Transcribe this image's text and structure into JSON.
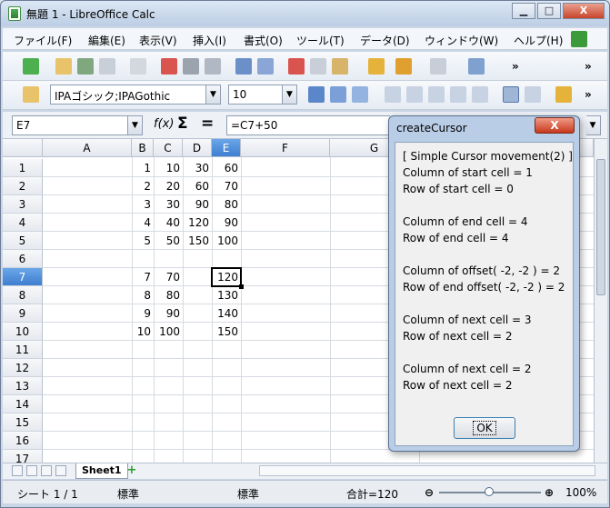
{
  "window": {
    "title": "無題 1 - LibreOffice Calc",
    "min": "▁",
    "max": "□",
    "close": "X"
  },
  "menu": [
    "ファイル(F)",
    "編集(E)",
    "表示(V)",
    "挿入(I)",
    "書式(O)",
    "ツール(T)",
    "データ(D)",
    "ウィンドウ(W)",
    "ヘルプ(H)"
  ],
  "format": {
    "font_name": "IPAゴシック;IPAGothic",
    "font_size": "10"
  },
  "formula": {
    "cell_ref": "E7",
    "content": "=C7+50"
  },
  "columns": [
    "A",
    "B",
    "C",
    "D",
    "E",
    "F",
    "G"
  ],
  "rows": [
    "1",
    "2",
    "3",
    "4",
    "5",
    "6",
    "7",
    "8",
    "9",
    "10",
    "11",
    "12",
    "13",
    "14",
    "15",
    "16",
    "17"
  ],
  "cells": {
    "B": [
      "1",
      "2",
      "3",
      "4",
      "5",
      "",
      "7",
      "8",
      "9",
      "10"
    ],
    "C": [
      "10",
      "20",
      "30",
      "40",
      "50",
      "",
      "70",
      "80",
      "90",
      "100"
    ],
    "D": [
      "30",
      "60",
      "90",
      "120",
      "150",
      "",
      "",
      "",
      "",
      ""
    ],
    "E": [
      "60",
      "70",
      "80",
      "90",
      "100",
      "",
      "120",
      "130",
      "140",
      "150"
    ]
  },
  "sheet_tab": "Sheet1",
  "status": {
    "sheet": "シート 1 / 1",
    "style": "標準",
    "mode": "標準",
    "sum": "合計=120",
    "zoom": "100%"
  },
  "dialog": {
    "title": "createCursor",
    "lines": [
      "[ Simple Cursor movement(2) ]",
      "Column of start cell = 1",
      "Row of start cell = 0",
      "",
      "Column of end cell = 4",
      "Row of end cell = 4",
      "",
      "Column of offset( -2, -2 ) = 2",
      "Row of end offset( -2, -2 ) = 2",
      "",
      "Column of next cell = 3",
      "Row of next cell = 2",
      "",
      "Column of next cell = 2",
      "Row of next cell = 2"
    ],
    "ok": "OK",
    "close": "X"
  }
}
